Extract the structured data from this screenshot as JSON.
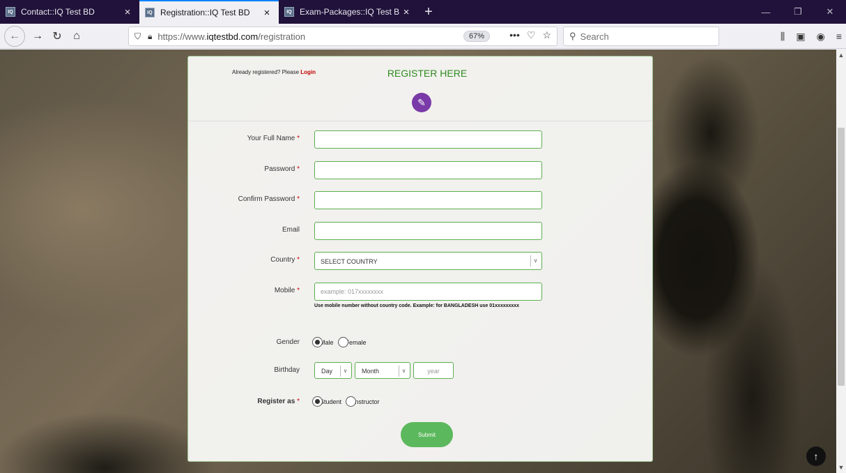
{
  "browser": {
    "tabs": [
      {
        "title": "Contact::IQ Test BD",
        "active": false
      },
      {
        "title": "Registration::IQ Test BD",
        "active": true
      },
      {
        "title": "Exam-Packages::IQ Test BD",
        "active": false
      }
    ],
    "favicon_text": "IQ",
    "url_prefix": "https://www.",
    "url_domain": "iqtestbd.com",
    "url_path": "/registration",
    "zoom": "67%",
    "search_placeholder": "Search"
  },
  "page": {
    "already_text": "Already registered? Please ",
    "login_link": "Login",
    "title": "REGISTER HERE",
    "submit_label": "Submit",
    "fields": {
      "full_name_label": "Your Full Name",
      "password_label": "Password",
      "confirm_password_label": "Confirm Password",
      "email_label": "Email",
      "country_label": "Country",
      "country_value": "SELECT COUNTRY",
      "mobile_label": "Mobile",
      "mobile_placeholder": "example: 017xxxxxxxx",
      "mobile_hint": "Use mobile number without country code. Example: for BANGLADESH use 01xxxxxxxxx",
      "gender_label": "Gender",
      "gender_male": "Male",
      "gender_female": "Female",
      "birthday_label": "Birthday",
      "day_value": "Day",
      "month_value": "Month",
      "year_placeholder": "year",
      "register_as_label": "Register as",
      "role_student": "Student",
      "role_instructor": "Instructor",
      "required_mark": "*"
    }
  },
  "colors": {
    "accent_green": "#5cb85c",
    "title_green": "#2f8a1e",
    "required_red": "#c20000",
    "icon_purple": "#7a3aa8"
  }
}
